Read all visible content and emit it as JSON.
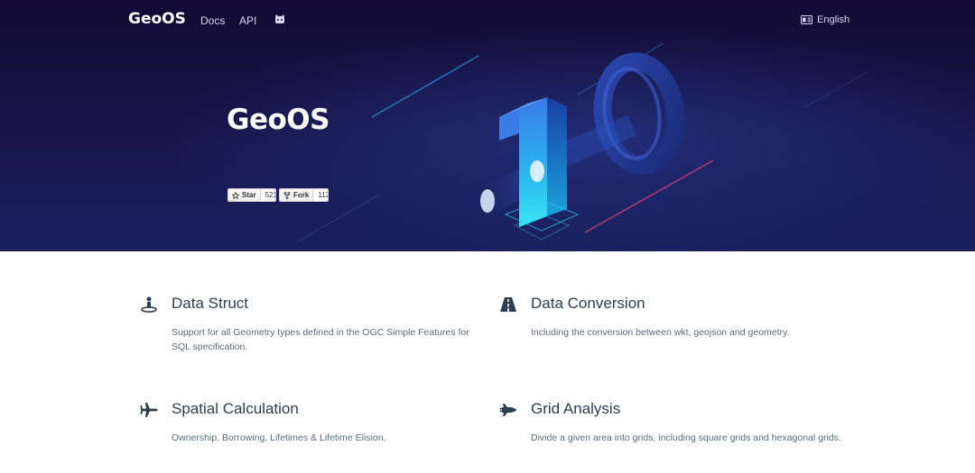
{
  "colors": {
    "hero_bg_top": "#120a33",
    "hero_bg_bottom": "#1a2160",
    "accent_cyan": "#2fd2f5",
    "accent_blue": "#2a64d8",
    "text_dark": "#2c3e50",
    "text_muted": "#5a6b7b"
  },
  "nav": {
    "brand": "GeoOS",
    "links": [
      {
        "label": "Docs"
      },
      {
        "label": "API"
      }
    ],
    "github_icon": "github-icon",
    "language": {
      "icon": "translate-icon",
      "label": "English"
    }
  },
  "hero": {
    "title": "GeoOS",
    "art": "isometric-1-0-version-graphic",
    "badges": {
      "star": {
        "icon": "star-icon",
        "label": "Star",
        "count": "521"
      },
      "fork": {
        "icon": "fork-icon",
        "label": "Fork",
        "count": "112"
      }
    }
  },
  "features": [
    {
      "icon": "person-pin-icon",
      "title": "Data Struct",
      "description": "Support for all Geometry types defined in the OGC Simple Features for SQL specification."
    },
    {
      "icon": "road-icon",
      "title": "Data Conversion",
      "description": "Including the conversion between wkt, geojson and geometry."
    },
    {
      "icon": "plane-icon",
      "title": "Spatial Calculation",
      "description": "Ownership, Borrowing, Lifetimes & Lifetime Elision."
    },
    {
      "icon": "space-shuttle-icon",
      "title": "Grid Analysis",
      "description": "Divide a given area into grids, including square grids and hexagonal grids."
    }
  ]
}
